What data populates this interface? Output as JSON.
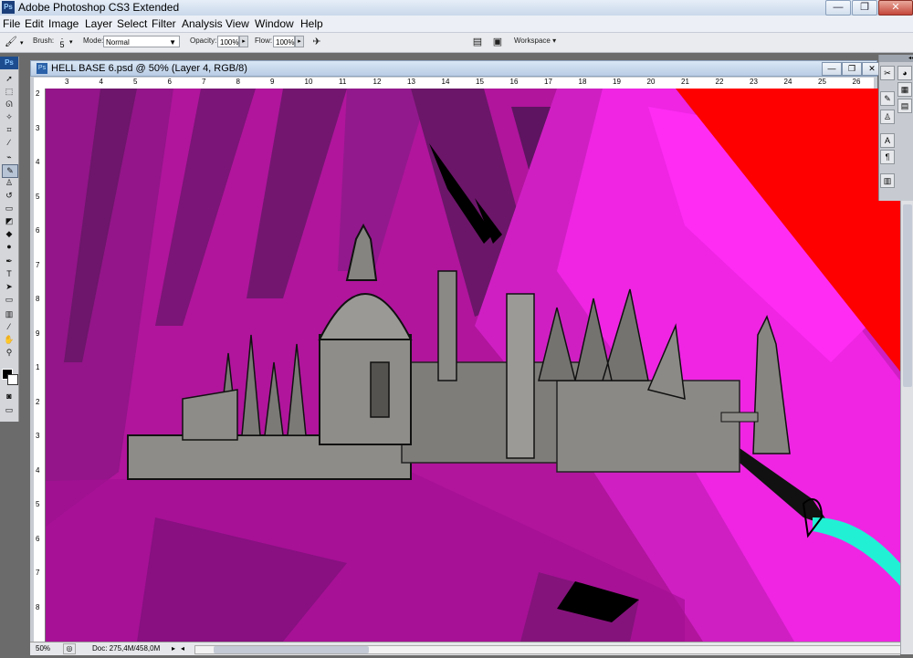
{
  "app": {
    "title": "Adobe Photoshop CS3 Extended",
    "logo": "Ps"
  },
  "window_controls": {
    "minimize": "—",
    "maximize": "❐",
    "close": "✕"
  },
  "menu": [
    "File",
    "Edit",
    "Image",
    "Layer",
    "Select",
    "Filter",
    "Analysis",
    "View",
    "Window",
    "Help"
  ],
  "options": {
    "brush_label": "Brush:",
    "brush_size": "5",
    "mode_label": "Mode:",
    "mode_value": "Normal",
    "opacity_label": "Opacity:",
    "opacity_value": "100%",
    "flow_label": "Flow:",
    "flow_value": "100%",
    "workspace_label": "Workspace"
  },
  "toolbox": {
    "logo": "Ps"
  },
  "document": {
    "title": "HELL BASE 6.psd @ 50% (Layer 4, RGB/8)",
    "ruler_h": [
      "3",
      "4",
      "5",
      "6",
      "7",
      "8",
      "9",
      "10",
      "11",
      "12",
      "13",
      "14",
      "15",
      "16",
      "17",
      "18",
      "19",
      "20",
      "21",
      "22",
      "23",
      "24",
      "25",
      "26"
    ],
    "ruler_v": [
      "2",
      "3",
      "4",
      "5",
      "6",
      "7",
      "8",
      "9",
      "1",
      "2",
      "3",
      "4",
      "5",
      "6",
      "7",
      "8"
    ]
  },
  "status": {
    "zoom": "50%",
    "doc_info": "Doc: 275,4M/458,0M"
  },
  "colors": {
    "magenta": "#b4139f",
    "pink": "#ff23ee",
    "purple": "#6d166b",
    "red": "#ff0000",
    "castle_gray": "#8d8c88",
    "cyan": "#22f0d5"
  }
}
